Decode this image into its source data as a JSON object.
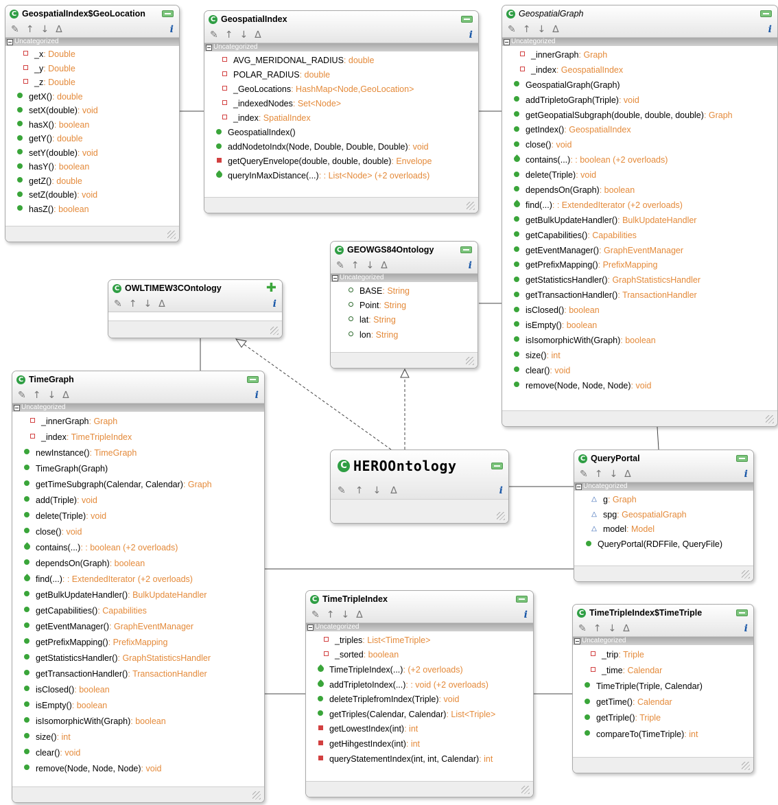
{
  "section_label": "Uncategorized",
  "classes": [
    {
      "id": "geolocation",
      "title": "GeospatialIndex$GeoLocation",
      "members": [
        {
          "v": "priv",
          "n": "_x",
          "r": "Double"
        },
        {
          "v": "priv",
          "n": "_y",
          "r": "Double"
        },
        {
          "v": "priv",
          "n": "_z",
          "r": "Double"
        },
        {
          "v": "pub",
          "n": "getX()",
          "r": "double"
        },
        {
          "v": "pub",
          "n": "setX(double)",
          "r": "void"
        },
        {
          "v": "pub",
          "n": "hasX()",
          "r": "boolean"
        },
        {
          "v": "pub",
          "n": "getY()",
          "r": "double"
        },
        {
          "v": "pub",
          "n": "setY(double)",
          "r": "void"
        },
        {
          "v": "pub",
          "n": "hasY()",
          "r": "boolean"
        },
        {
          "v": "pub",
          "n": "getZ()",
          "r": "double"
        },
        {
          "v": "pub",
          "n": "setZ(double)",
          "r": "void"
        },
        {
          "v": "pub",
          "n": "hasZ()",
          "r": "boolean"
        }
      ]
    },
    {
      "id": "geospatialindex",
      "title": "GeospatialIndex",
      "members": [
        {
          "v": "priv",
          "n": "AVG_MERIDONAL_RADIUS",
          "r": "double"
        },
        {
          "v": "priv",
          "n": "POLAR_RADIUS",
          "r": "double"
        },
        {
          "v": "priv",
          "n": "_GeoLocations",
          "r": "HashMap<Node,GeoLocation>"
        },
        {
          "v": "priv",
          "n": "_indexedNodes",
          "r": "Set<Node>"
        },
        {
          "v": "priv",
          "n": "_index",
          "r": "SpatialIndex"
        },
        {
          "v": "pub",
          "n": "GeospatialIndex()",
          "r": ""
        },
        {
          "v": "pub",
          "n": "addNodetoIndx(Node, Double, Double, Double)",
          "r": "void"
        },
        {
          "v": "prot",
          "n": "getQueryEnvelope(double, double, double)",
          "r": "Envelope"
        },
        {
          "v": "over",
          "n": "queryInMaxDistance(...)",
          "r": ": List<Node> (+2 overloads)"
        }
      ]
    },
    {
      "id": "geospatialgraph",
      "title": "GeospatialGraph",
      "italic": true,
      "members": [
        {
          "v": "priv",
          "n": "_innerGraph",
          "r": "Graph"
        },
        {
          "v": "priv",
          "n": "_index",
          "r": "GeospatialIndex"
        },
        {
          "v": "pub",
          "n": "GeospatialGraph(Graph)",
          "r": ""
        },
        {
          "v": "pub",
          "n": "addTripletoGraph(Triple)",
          "r": "void"
        },
        {
          "v": "pub",
          "n": "getGeopatialSubgraph(double, double, double)",
          "r": "Graph"
        },
        {
          "v": "pub",
          "n": "getIndex()",
          "r": "GeospatialIndex"
        },
        {
          "v": "pub",
          "n": "close()",
          "r": "void"
        },
        {
          "v": "over",
          "n": "contains(...)",
          "r": ": boolean (+2 overloads)"
        },
        {
          "v": "pub",
          "n": "delete(Triple)",
          "r": "void"
        },
        {
          "v": "pub",
          "n": "dependsOn(Graph)",
          "r": "boolean"
        },
        {
          "v": "over",
          "n": "find(...)",
          "r": ": ExtendedIterator (+2 overloads)"
        },
        {
          "v": "pub",
          "n": "getBulkUpdateHandler()",
          "r": "BulkUpdateHandler"
        },
        {
          "v": "pub",
          "n": "getCapabilities()",
          "r": "Capabilities"
        },
        {
          "v": "pub",
          "n": "getEventManager()",
          "r": "GraphEventManager"
        },
        {
          "v": "pub",
          "n": "getPrefixMapping()",
          "r": "PrefixMapping"
        },
        {
          "v": "pub",
          "n": "getStatisticsHandler()",
          "r": "GraphStatisticsHandler"
        },
        {
          "v": "pub",
          "n": "getTransactionHandler()",
          "r": "TransactionHandler"
        },
        {
          "v": "pub",
          "n": "isClosed()",
          "r": "boolean"
        },
        {
          "v": "pub",
          "n": "isEmpty()",
          "r": "boolean"
        },
        {
          "v": "pub",
          "n": "isIsomorphicWith(Graph)",
          "r": "boolean"
        },
        {
          "v": "pub",
          "n": "size()",
          "r": "int"
        },
        {
          "v": "pub",
          "n": "clear()",
          "r": "void"
        },
        {
          "v": "pub",
          "n": "remove(Node, Node, Node)",
          "r": "void"
        }
      ]
    },
    {
      "id": "wgs84",
      "title": "GEOWGS84Ontology",
      "members": [
        {
          "v": "const",
          "n": "BASE",
          "r": "String"
        },
        {
          "v": "const",
          "n": "Point",
          "r": "String"
        },
        {
          "v": "const",
          "n": "lat",
          "r": "String"
        },
        {
          "v": "const",
          "n": "lon",
          "r": "String"
        }
      ]
    },
    {
      "id": "owltime",
      "title": "OWLTIMEW3COntology",
      "collapsed": true,
      "members": []
    },
    {
      "id": "timegraph",
      "title": "TimeGraph",
      "members": [
        {
          "v": "priv",
          "n": "_innerGraph",
          "r": "Graph"
        },
        {
          "v": "priv",
          "n": "_index",
          "r": "TimeTripleIndex"
        },
        {
          "v": "pub",
          "n": "newInstance()",
          "r": "TimeGraph"
        },
        {
          "v": "pub",
          "n": "TimeGraph(Graph)",
          "r": ""
        },
        {
          "v": "pub",
          "n": "getTimeSubgraph(Calendar, Calendar)",
          "r": "Graph"
        },
        {
          "v": "pub",
          "n": "add(Triple)",
          "r": "void"
        },
        {
          "v": "pub",
          "n": "delete(Triple)",
          "r": "void"
        },
        {
          "v": "pub",
          "n": "close()",
          "r": "void"
        },
        {
          "v": "over",
          "n": "contains(...)",
          "r": ": boolean (+2 overloads)"
        },
        {
          "v": "pub",
          "n": "dependsOn(Graph)",
          "r": "boolean"
        },
        {
          "v": "over",
          "n": "find(...)",
          "r": ": ExtendedIterator (+2 overloads)"
        },
        {
          "v": "pub",
          "n": "getBulkUpdateHandler()",
          "r": "BulkUpdateHandler"
        },
        {
          "v": "pub",
          "n": "getCapabilities()",
          "r": "Capabilities"
        },
        {
          "v": "pub",
          "n": "getEventManager()",
          "r": "GraphEventManager"
        },
        {
          "v": "pub",
          "n": "getPrefixMapping()",
          "r": "PrefixMapping"
        },
        {
          "v": "pub",
          "n": "getStatisticsHandler()",
          "r": "GraphStatisticsHandler"
        },
        {
          "v": "pub",
          "n": "getTransactionHandler()",
          "r": "TransactionHandler"
        },
        {
          "v": "pub",
          "n": "isClosed()",
          "r": "boolean"
        },
        {
          "v": "pub",
          "n": "isEmpty()",
          "r": "boolean"
        },
        {
          "v": "pub",
          "n": "isIsomorphicWith(Graph)",
          "r": "boolean"
        },
        {
          "v": "pub",
          "n": "size()",
          "r": "int"
        },
        {
          "v": "pub",
          "n": "clear()",
          "r": "void"
        },
        {
          "v": "pub",
          "n": "remove(Node, Node, Node)",
          "r": "void"
        }
      ]
    },
    {
      "id": "hero",
      "title": "HEROOntology",
      "collapsed": true,
      "hero": true,
      "members": []
    },
    {
      "id": "queryportal",
      "title": "QueryPortal",
      "members": [
        {
          "v": "internal",
          "n": "g",
          "r": "Graph"
        },
        {
          "v": "internal",
          "n": "spg",
          "r": "GeospatialGraph"
        },
        {
          "v": "internal",
          "n": "model",
          "r": "Model"
        },
        {
          "v": "pub",
          "n": "QueryPortal(RDFFile, QueryFile)",
          "r": ""
        }
      ]
    },
    {
      "id": "timetripleindex",
      "title": "TimeTripleIndex",
      "members": [
        {
          "v": "priv",
          "n": "_triples",
          "r": "List<TimeTriple>"
        },
        {
          "v": "priv",
          "n": "_sorted",
          "r": "boolean"
        },
        {
          "v": "over",
          "n": "TimeTripleIndex(...)",
          "r": "(+2 overloads)"
        },
        {
          "v": "over",
          "n": "addTripletoIndex(...)",
          "r": ": void (+2 overloads)"
        },
        {
          "v": "pub",
          "n": "deleteTriplefromIndex(Triple)",
          "r": "void"
        },
        {
          "v": "pub",
          "n": "getTriples(Calendar, Calendar)",
          "r": "List<Triple>"
        },
        {
          "v": "prot",
          "n": "getLowestIndex(int)",
          "r": "int"
        },
        {
          "v": "prot",
          "n": "getHihgestIndex(int)",
          "r": "int"
        },
        {
          "v": "prot",
          "n": "queryStatementIndex(int, int, Calendar)",
          "r": "int"
        }
      ]
    },
    {
      "id": "timetriple",
      "title": "TimeTripleIndex$TimeTriple",
      "members": [
        {
          "v": "priv",
          "n": "_trip",
          "r": "Triple"
        },
        {
          "v": "priv",
          "n": "_time",
          "r": "Calendar"
        },
        {
          "v": "pub",
          "n": "TimeTriple(Triple, Calendar)",
          "r": ""
        },
        {
          "v": "pub",
          "n": "getTime()",
          "r": "Calendar"
        },
        {
          "v": "pub",
          "n": "getTriple()",
          "r": "Triple"
        },
        {
          "v": "pub",
          "n": "compareTo(TimeTriple)",
          "r": "int"
        }
      ]
    }
  ]
}
